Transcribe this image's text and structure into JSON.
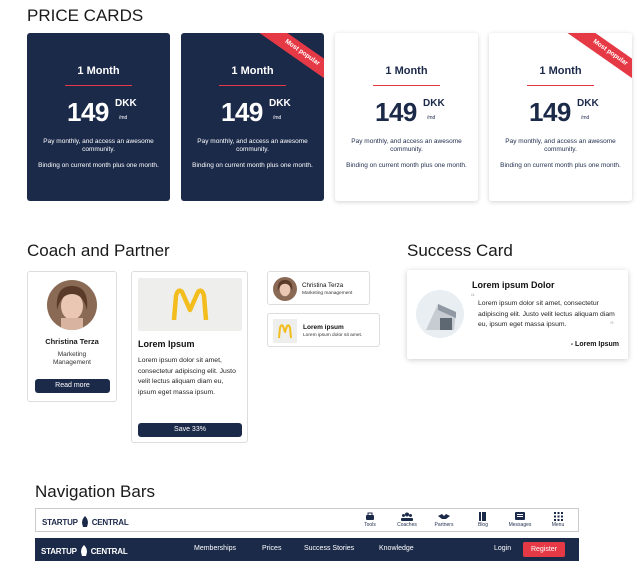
{
  "sections": {
    "price_cards": "PRICE CARDS",
    "coach_partner": "Coach and Partner",
    "success_card": "Success Card",
    "navigation_bars": "Navigation Bars"
  },
  "price_cards": [
    {
      "title": "1 Month",
      "price": "149",
      "currency": "DKK",
      "period": "/md",
      "desc1": "Pay monthly, and access an awesome community.",
      "desc2": "Binding on current month plus one month.",
      "ribbon": ""
    },
    {
      "title": "1 Month",
      "price": "149",
      "currency": "DKK",
      "period": "/md",
      "desc1": "Pay monthly, and access an awesome community.",
      "desc2": "Binding on current month plus one month.",
      "ribbon": "Most popular"
    },
    {
      "title": "1 Month",
      "price": "149",
      "currency": "DKK",
      "period": "/md",
      "desc1": "Pay monthly, and access an awesome community.",
      "desc2": "Binding on current month plus one month.",
      "ribbon": ""
    },
    {
      "title": "1 Month",
      "price": "149",
      "currency": "DKK",
      "period": "/md",
      "desc1": "Pay monthly, and access an awesome community.",
      "desc2": "Binding on current month plus one month.",
      "ribbon": "Most popular"
    }
  ],
  "coach_card": {
    "name": "Christina Terza",
    "role": "Marketing Management",
    "button": "Read more"
  },
  "partner_card": {
    "title": "Lorem Ipsum",
    "text": "Lorem ipsum dolor sit amet, consectetur adipiscing elit. Justo velit lectus aliquam diam eu, ipsum eget massa ipsum.",
    "button": "Save 33%"
  },
  "mini_coach": {
    "name": "Christina Terza",
    "role": "Marketing management"
  },
  "mini_partner": {
    "title": "Lorem ipsum",
    "text": "Lorem ipsum dolor sit amet."
  },
  "success_card": {
    "title": "Lorem ipsum Dolor",
    "quote": "Lorem ipsum dolor sit amet, consectetur adipiscing elit. Justo velit lectus aliquam diam eu, ipsum eget massa ipsum.",
    "author": "- Lorem Ipsum"
  },
  "nav_light": {
    "logo_left": "STARTUP",
    "logo_right": "CENTRAL",
    "items": [
      {
        "label": "Tools",
        "icon": "tools-icon"
      },
      {
        "label": "Coaches",
        "icon": "coaches-icon"
      },
      {
        "label": "Partners",
        "icon": "partners-icon"
      },
      {
        "label": "Blog",
        "icon": "blog-icon"
      },
      {
        "label": "Messages",
        "icon": "messages-icon"
      },
      {
        "label": "Menu",
        "icon": "menu-icon"
      }
    ]
  },
  "nav_dark": {
    "logo_left": "STARTUP",
    "logo_right": "CENTRAL",
    "links": [
      "Memberships",
      "Prices",
      "Success Stories",
      "Knowledge"
    ],
    "login": "Login",
    "register": "Register"
  },
  "colors": {
    "navy": "#1c2a4a",
    "accent": "#e63946"
  }
}
